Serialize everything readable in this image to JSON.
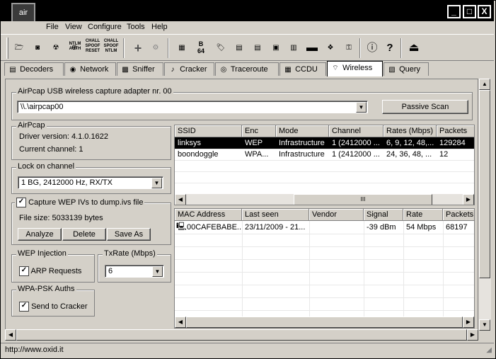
{
  "app": {
    "logo_text": "air"
  },
  "window_buttons": [
    "_",
    "□",
    "X"
  ],
  "menu": [
    "File",
    "View",
    "Configure",
    "Tools",
    "Help"
  ],
  "toolbar": {
    "icons": [
      "open-folder-icon",
      "save-icon",
      "biohazard-icon",
      "web-icon",
      "ntlm-auth-icon",
      "cmll-spoof-reset-icon",
      "cmll-spoof-ntlm-icon",
      "add-icon",
      "clear-icon",
      "grid-icon",
      "base64-icon",
      "tag-icon",
      "hash-icon",
      "hash2-icon",
      "terminal-icon",
      "hardware-icon",
      "record-icon",
      "network-icon",
      "key-icon",
      "info-icon",
      "help-icon",
      "exit-icon"
    ],
    "labels": {
      "ntlm": "NTLM\nAUTH",
      "spoof_reset": "CHALL\nSPOOF\nRESET",
      "spoof_ntlm": "CHALL\nSPOOF\nNTLM",
      "b64": "B\n64"
    }
  },
  "tabs": [
    {
      "label": "Decoders",
      "icon": "decoders-icon"
    },
    {
      "label": "Network",
      "icon": "network-icon"
    },
    {
      "label": "Sniffer",
      "icon": "sniffer-icon"
    },
    {
      "label": "Cracker",
      "icon": "cracker-icon"
    },
    {
      "label": "Traceroute",
      "icon": "traceroute-icon"
    },
    {
      "label": "CCDU",
      "icon": "ccdu-icon"
    },
    {
      "label": "Wireless",
      "icon": "wireless-icon"
    },
    {
      "label": "Query",
      "icon": "query-icon"
    }
  ],
  "adapter_group": {
    "title": "AirPcap USB wireless capture adapter nr. 00",
    "adapter_value": "\\\\.\\airpcap00",
    "scan_button": "Passive Scan"
  },
  "airpcap_group": {
    "title": "AirPcap",
    "driver": "Driver version: 4.1.0.1622",
    "channel": "Current channel: 1"
  },
  "lock_group": {
    "title": "Lock on channel",
    "value": "1 BG, 2412000 Hz, RX/TX"
  },
  "capture_group": {
    "checkbox_label": "Capture WEP IVs to dump.ivs file",
    "checked": true,
    "file_size": "File size: 5033139 bytes",
    "buttons": [
      "Analyze",
      "Delete",
      "Save As"
    ]
  },
  "wep_group": {
    "title": "WEP Injection",
    "checkbox_label": "ARP Requests",
    "checked": true
  },
  "txrate_group": {
    "title": "TxRate (Mbps)",
    "value": "6"
  },
  "wpa_group": {
    "title": "WPA-PSK Auths",
    "checkbox_label": "Send to Cracker",
    "checked": true
  },
  "ap_table": {
    "columns": [
      "SSID",
      "Enc",
      "Mode",
      "Channel",
      "Rates (Mbps)",
      "Packets"
    ],
    "rows": [
      [
        "linksys",
        "WEP",
        "Infrastructure",
        "1 (2412000 ...",
        "6, 9, 12, 48,...",
        "129284"
      ],
      [
        "boondoggle",
        "WPA...",
        "Infrastructure",
        "1 (2412000 ...",
        "24, 36, 48, ...",
        "12"
      ]
    ],
    "selected_row": 0,
    "scroll_label": "III"
  },
  "client_table": {
    "columns": [
      "MAC Address",
      "Last seen",
      "Vendor",
      "Signal",
      "Rate",
      "Packets"
    ],
    "rows": [
      [
        "00CAFEBABE...",
        "23/11/2009 - 21...",
        "",
        "-39 dBm",
        "54 Mbps",
        "68197"
      ]
    ]
  },
  "status": {
    "url": "http://www.oxid.it"
  }
}
